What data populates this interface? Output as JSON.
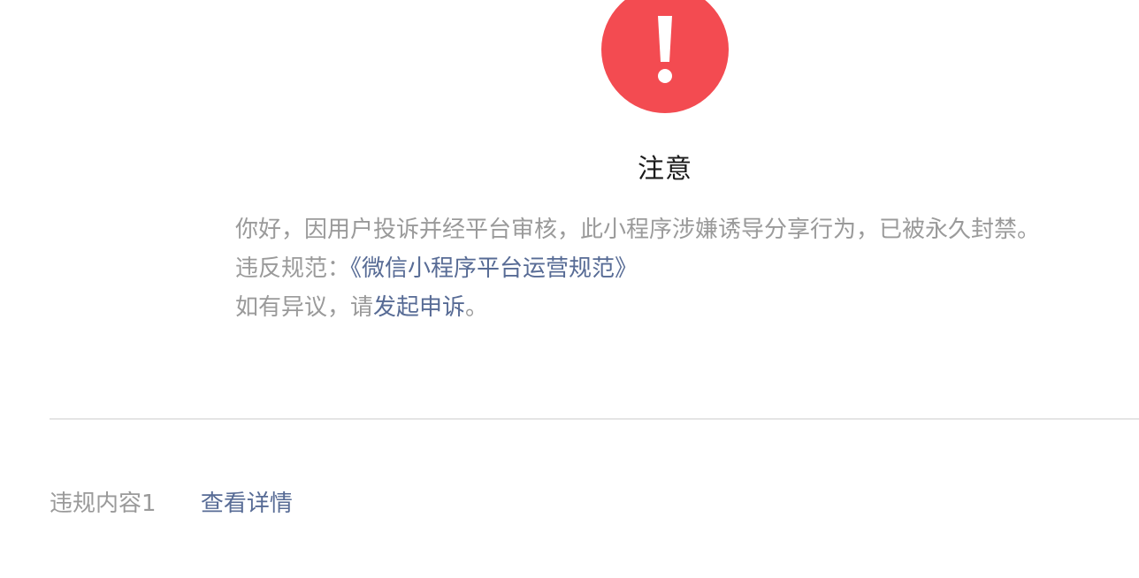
{
  "alert": {
    "icon": "exclamation-circle-icon",
    "icon_color": "#f34b51",
    "title": "注意"
  },
  "message": {
    "body": "你好，因用户投诉并经平台审核，此小程序涉嫌诱导分享行为，已被永久封禁。",
    "violation_prefix": "违反规范：",
    "violation_link": "《微信小程序平台运营规范》",
    "appeal_prefix": "如有异议，请",
    "appeal_link": "发起申诉",
    "appeal_suffix": "。"
  },
  "violations": {
    "items": [
      {
        "label": "违规内容1",
        "action": "查看详情"
      }
    ]
  },
  "colors": {
    "link": "#576b95",
    "muted_text": "#9a9a9a",
    "title_text": "#1a1a1a"
  }
}
